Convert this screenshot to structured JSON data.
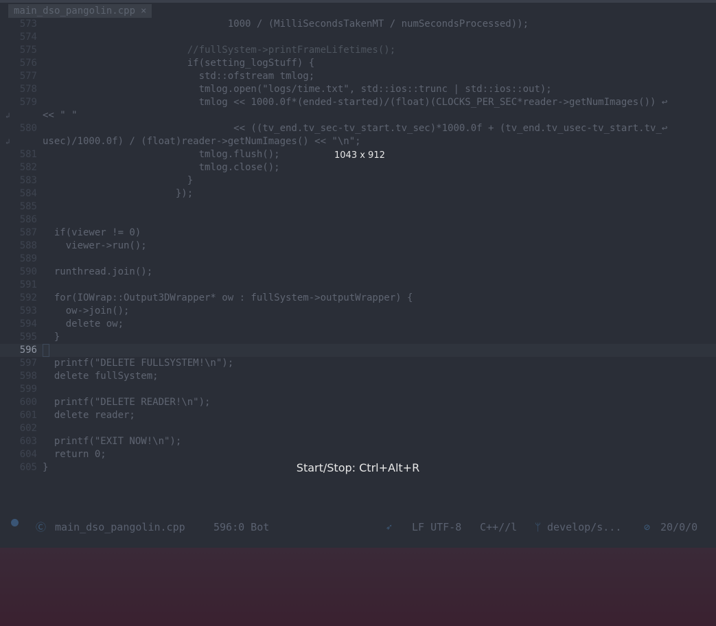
{
  "tab": {
    "filename": "main_dso_pangolin.cpp",
    "close": "×"
  },
  "lines": [
    {
      "num": "573",
      "text": "                                1000 / (MilliSecondsTakenMT / numSecondsProcessed));"
    },
    {
      "num": "574",
      "text": ""
    },
    {
      "num": "575",
      "text": "                         //fullSystem->printFrameLifetimes();"
    },
    {
      "num": "576",
      "text": "                         if(setting_logStuff) {"
    },
    {
      "num": "577",
      "text": "                           std::ofstream tmlog;"
    },
    {
      "num": "578",
      "text": "                           tmlog.open(\"logs/time.txt\", std::ios::trunc | std::ios::out);"
    },
    {
      "num": "579",
      "text": "                           tmlog << 1000.0f*(ended-started)/(float)(CLOCKS_PER_SEC*reader->getNumImages()) ↩"
    },
    {
      "num": "",
      "text": "<< \" \""
    },
    {
      "num": "580",
      "text": "                                 << ((tv_end.tv_sec-tv_start.tv_sec)*1000.0f + (tv_end.tv_usec-tv_start.tv_↩"
    },
    {
      "num": "",
      "text": "usec)/1000.0f) / (float)reader->getNumImages() << \"\\n\";"
    },
    {
      "num": "581",
      "text": "                           tmlog.flush();"
    },
    {
      "num": "582",
      "text": "                           tmlog.close();"
    },
    {
      "num": "583",
      "text": "                         }"
    },
    {
      "num": "584",
      "text": "                       });"
    },
    {
      "num": "585",
      "text": ""
    },
    {
      "num": "586",
      "text": ""
    },
    {
      "num": "587",
      "text": "  if(viewer != 0)"
    },
    {
      "num": "588",
      "text": "    viewer->run();"
    },
    {
      "num": "589",
      "text": ""
    },
    {
      "num": "590",
      "text": "  runthread.join();"
    },
    {
      "num": "591",
      "text": ""
    },
    {
      "num": "592",
      "text": "  for(IOWrap::Output3DWrapper* ow : fullSystem->outputWrapper) {"
    },
    {
      "num": "593",
      "text": "    ow->join();"
    },
    {
      "num": "594",
      "text": "    delete ow;"
    },
    {
      "num": "595",
      "text": "  }"
    },
    {
      "num": "596",
      "text": ""
    },
    {
      "num": "597",
      "text": "  printf(\"DELETE FULLSYSTEM!\\n\");"
    },
    {
      "num": "598",
      "text": "  delete fullSystem;"
    },
    {
      "num": "599",
      "text": ""
    },
    {
      "num": "600",
      "text": "  printf(\"DELETE READER!\\n\");"
    },
    {
      "num": "601",
      "text": "  delete reader;"
    },
    {
      "num": "602",
      "text": ""
    },
    {
      "num": "603",
      "text": "  printf(\"EXIT NOW!\\n\");"
    },
    {
      "num": "604",
      "text": "  return 0;"
    },
    {
      "num": "605",
      "text": "}"
    }
  ],
  "current_line": "596",
  "overlay": {
    "dimensions": "1043 x 912",
    "hint": "Start/Stop: Ctrl+Alt+R"
  },
  "status": {
    "filename": "main_dso_pangolin.cpp",
    "position": "596:0 Bot",
    "eol_encoding": "LF UTF-8",
    "language": "C++//l",
    "branch": "develop/s...",
    "counts": "20/0/0"
  }
}
